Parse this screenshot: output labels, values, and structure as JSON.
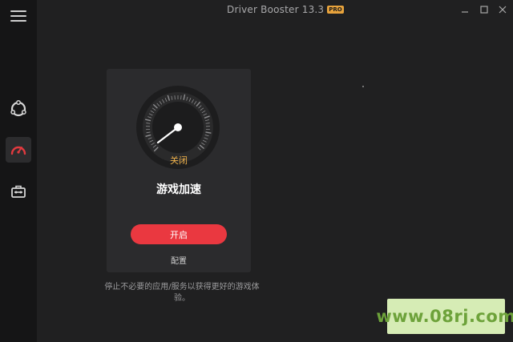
{
  "window": {
    "title": "Driver Booster 13.3",
    "badge": "PRO",
    "controls": {
      "minimize_icon": "minimize-icon",
      "maximize_icon": "maximize-icon",
      "close_icon": "close-icon"
    }
  },
  "sidebar": {
    "items": [
      {
        "name": "menu",
        "icon": "hamburger-menu-icon"
      },
      {
        "name": "scan",
        "icon": "ring-icon"
      },
      {
        "name": "game-boost",
        "icon": "speedometer-icon",
        "active": true
      },
      {
        "name": "toolbox",
        "icon": "toolbox-icon"
      }
    ]
  },
  "card": {
    "status": "关闭",
    "title": "游戏加速",
    "start_button": "开启",
    "config_link": "配置"
  },
  "description": "停止不必要的应用/服务以获得更好的游戏体验。",
  "watermark": "www.08rj.com",
  "colors": {
    "accent_red": "#ea3840",
    "status_orange": "#f0b24a",
    "badge_gold": "#e8a33c"
  }
}
